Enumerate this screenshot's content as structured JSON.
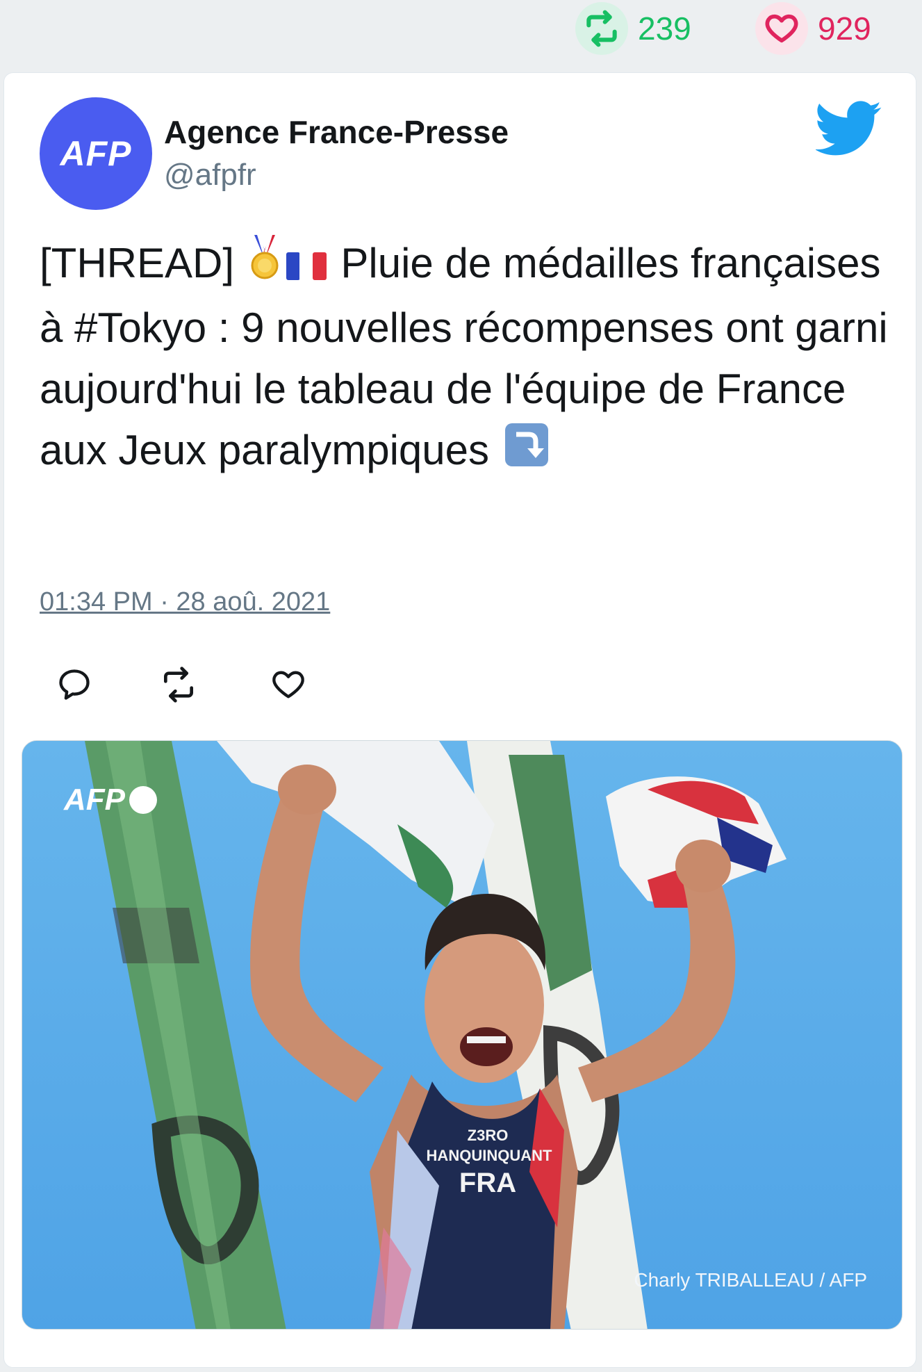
{
  "stats": {
    "retweets": "239",
    "likes": "929",
    "retweet_icon": "retweet-icon",
    "like_icon": "heart-icon"
  },
  "tweet": {
    "author_name": "Agence France-Presse",
    "author_handle": "@afpfr",
    "avatar_text": "AFP",
    "text_part1": "[THREAD]",
    "text_part2": "Pluie de médailles françaises à #Tokyo : 9 nouvelles récompenses ont garni aujourd'hui le tableau de l'équipe de France aux Jeux paralympiques",
    "timestamp": "01:34 PM · 28 aoû. 2021"
  },
  "media": {
    "watermark": "AFP",
    "credit": "Charly TRIBALLEAU / AFP",
    "bib_line1": "Z3RO",
    "bib_line2": "HANQUINQUANT",
    "bib_line3": "FRA"
  },
  "colors": {
    "retweet_green": "#17bf63",
    "like_red": "#e0245e",
    "twitter_blue": "#1da1f2",
    "avatar_blue": "#4a5cf0"
  }
}
